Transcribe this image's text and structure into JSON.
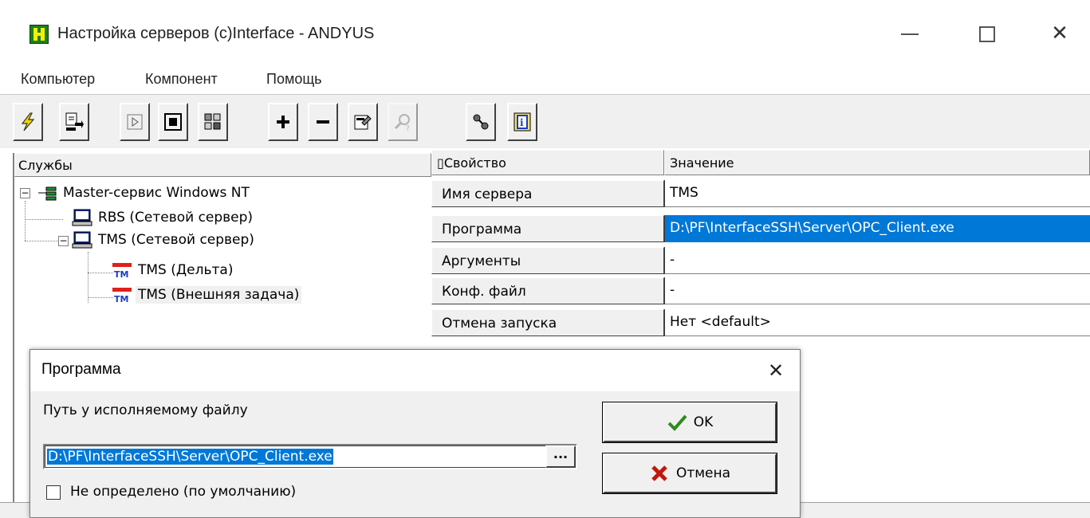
{
  "window": {
    "title": "Настройка серверов (c)Interface - ANDYUS",
    "minimize_glyph": "—",
    "maximize_glyph": "☐",
    "close_glyph": "✕"
  },
  "menu": [
    "Компьютер",
    "Компонент",
    "Помощь"
  ],
  "toolbar": {
    "icons": [
      "lightning-icon",
      "import-icon",
      "play-icon",
      "stop-icon",
      "service-icon",
      "add-icon",
      "remove-icon",
      "properties-icon",
      "search-icon",
      "connect-icon",
      "info-icon"
    ]
  },
  "tree": {
    "header": "Службы",
    "nodes": [
      {
        "label": "Master-сервис Windows NT",
        "level": 0,
        "icon": "network-icon",
        "expander": "−"
      },
      {
        "label": "RBS (Сетевой сервер)",
        "level": 1,
        "icon": "computer-icon"
      },
      {
        "label": "TMS (Сетевой сервер)",
        "level": 1,
        "icon": "computer-icon",
        "expander": "−"
      },
      {
        "label": "TMS (Дельта)",
        "level": 2,
        "icon": "tm-icon"
      },
      {
        "label": "TMS (Внешняя задача)",
        "level": 2,
        "icon": "tm-icon",
        "selected": true
      }
    ],
    "tm_text": "TM"
  },
  "grid": {
    "col_property": "Свойство",
    "col_value": "Значение",
    "rows": [
      {
        "key": "Имя сервера",
        "value": "TMS"
      },
      {
        "key": "Программа",
        "value": "D:\\PF\\InterfaceSSH\\Server\\OPC_Client.exe",
        "selected": true
      },
      {
        "key": "Аргументы",
        "value": "-"
      },
      {
        "key": "Конф. файл",
        "value": "-"
      },
      {
        "key": "Отмена запуска",
        "value": "Нет <default>"
      }
    ]
  },
  "dialog": {
    "title": "Программа",
    "close_glyph": "✕",
    "path_label": "Путь у исполняемому файлу",
    "path_value": "D:\\PF\\InterfaceSSH\\Server\\OPC_Client.exe",
    "browse_label": "...",
    "checkbox_label": "Не определено (по умолчанию)",
    "checkbox_checked": false,
    "ok_label": "OK",
    "cancel_label": "Отмена"
  },
  "colors": {
    "selection": "#0078d7",
    "ok_check": "#2e8b1e",
    "cancel_x": "#c0180c"
  }
}
